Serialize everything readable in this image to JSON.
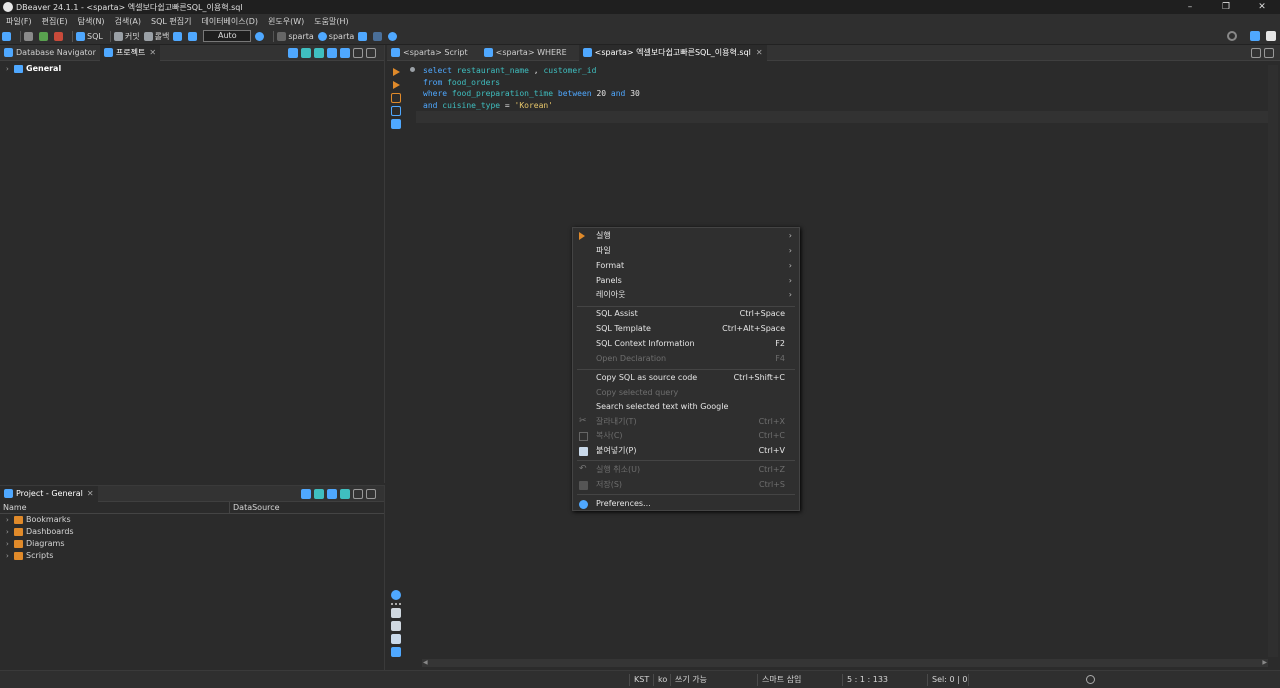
{
  "window": {
    "title": "DBeaver 24.1.1 - <sparta> 엑셀보다쉽고빠른SQL_이용혁.sql",
    "controls": [
      "–",
      "❐",
      "✕"
    ]
  },
  "menu": [
    "파일(F)",
    "편집(E)",
    "탐색(N)",
    "검색(A)",
    "SQL 편집기",
    "데이터베이스(D)",
    "윈도우(W)",
    "도움말(H)"
  ],
  "toolbar": {
    "sql_label": "SQL",
    "commit_label": "커밋",
    "rollback_label": "롤백",
    "tx_mode": "Auto",
    "datasource": "sparta",
    "schema": "sparta"
  },
  "navigator": {
    "tabs": [
      "Database Navigator",
      "프로젝트"
    ],
    "tree": [
      "General"
    ]
  },
  "project": {
    "tab": "Project - General",
    "columns": [
      "Name",
      "DataSource"
    ],
    "items": [
      "Bookmarks",
      "Dashboards",
      "Diagrams",
      "Scripts"
    ]
  },
  "editor": {
    "tabs": [
      "<sparta> Script",
      "<sparta> WHERE",
      "<sparta> 엑셀보다쉽고빠른SQL_이용혁.sql"
    ],
    "code": {
      "l1_kw": "select",
      "l1_a": "restaurant_name",
      "l1_sep": " , ",
      "l1_b": "customer_id",
      "l2_kw": "from",
      "l2_a": "food_orders",
      "l3_kw": "where",
      "l3_a": "food_preparation_time",
      "l3_between": "between",
      "l3_n1": "20",
      "l3_and": "and",
      "l3_n2": "30",
      "l4_kw": "and",
      "l4_a": "cuisine_type",
      "l4_eq": " = ",
      "l4_str": "'Korean'"
    }
  },
  "context_menu": {
    "run": "실행",
    "file": "파일",
    "format": "Format",
    "panels": "Panels",
    "layout": "레이아웃",
    "sql_assist": "SQL Assist",
    "sql_assist_sc": "Ctrl+Space",
    "sql_template": "SQL Template",
    "sql_template_sc": "Ctrl+Alt+Space",
    "sql_context": "SQL Context Information",
    "sql_context_sc": "F2",
    "open_decl": "Open Declaration",
    "open_decl_sc": "F4",
    "copy_source": "Copy SQL as source code",
    "copy_source_sc": "Ctrl+Shift+C",
    "copy_query": "Copy selected query",
    "search_google": "Search selected text with Google",
    "cut": "잘라내기(T)",
    "cut_sc": "Ctrl+X",
    "copy": "복사(C)",
    "copy_sc": "Ctrl+C",
    "paste": "붙여넣기(P)",
    "paste_sc": "Ctrl+V",
    "undo": "실행 취소(U)",
    "undo_sc": "Ctrl+Z",
    "save": "저장(S)",
    "save_sc": "Ctrl+S",
    "prefs": "Preferences..."
  },
  "status": {
    "tz": "KST",
    "locale": "ko",
    "mode": "쓰기 가능",
    "insert": "스마트 삽입",
    "pos": "5 : 1 : 133",
    "sel": "Sel: 0 | 0"
  },
  "colors": {
    "accent": "#4fa8ff",
    "keyword": "#4fa8ff",
    "identifier": "#3fbfc0",
    "string": "#e8c76a",
    "folder": "#e08a2a"
  }
}
